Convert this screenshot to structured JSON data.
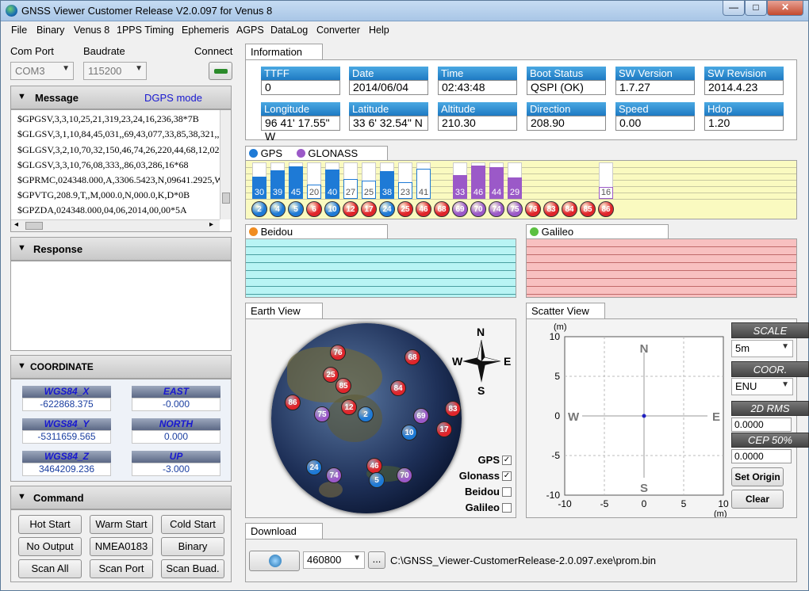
{
  "window": {
    "title": "GNSS Viewer Customer Release V2.0.097 for Venus 8",
    "buttons": {
      "minimize": "—",
      "maximize": "□",
      "close": "✕"
    }
  },
  "menu": [
    "File",
    "Binary",
    "Venus 8",
    "1PPS Timing",
    "Ephemeris",
    "AGPS",
    "DataLog",
    "Converter",
    "Help"
  ],
  "connection": {
    "com_port_label": "Com Port",
    "com_port_value": "COM3",
    "baudrate_label": "Baudrate",
    "baudrate_value": "115200",
    "connect_label": "Connect"
  },
  "message": {
    "title": "Message",
    "mode": "DGPS mode",
    "lines": [
      "$GPGSV,3,3,10,25,21,319,23,24,16,236,38*7B",
      "$GLGSV,3,1,10,84,45,031,,69,43,077,33,85,38,321,,",
      "$GLGSV,3,2,10,70,32,150,46,74,26,220,44,68,12,020",
      "$GLGSV,3,3,10,76,08,333,,86,03,286,16*68",
      "$GPRMC,024348.000,A,3306.5423,N,09641.2925,W",
      "$GPVTG,208.9,T,,M,000.0,N,000.0,K,D*0B",
      "$GPZDA,024348.000,04,06,2014,00,00*5A"
    ]
  },
  "response": {
    "title": "Response"
  },
  "coordinate": {
    "title": "COORDINATE",
    "items": [
      {
        "label": "WGS84_X",
        "value": "-622868.375"
      },
      {
        "label": "EAST",
        "value": "-0.000"
      },
      {
        "label": "WGS84_Y",
        "value": "-5311659.565"
      },
      {
        "label": "NORTH",
        "value": "0.000"
      },
      {
        "label": "WGS84_Z",
        "value": "3464209.236"
      },
      {
        "label": "UP",
        "value": "-3.000"
      }
    ]
  },
  "command": {
    "title": "Command",
    "buttons": [
      "Hot Start",
      "Warm Start",
      "Cold Start",
      "No Output",
      "NMEA0183",
      "Binary",
      "Scan All",
      "Scan Port",
      "Scan Buad."
    ]
  },
  "information": {
    "tab": "Information",
    "fields": [
      {
        "label": "TTFF",
        "value": "0"
      },
      {
        "label": "Date",
        "value": "2014/06/04"
      },
      {
        "label": "Time",
        "value": "02:43:48"
      },
      {
        "label": "Boot Status",
        "value": "QSPI (OK)"
      },
      {
        "label": "SW Version",
        "value": "1.7.27"
      },
      {
        "label": "SW Revision",
        "value": "2014.4.23"
      },
      {
        "label": "Longitude",
        "value": "96 41' 17.55\" W"
      },
      {
        "label": "Latitude",
        "value": "33 6' 32.54\" N"
      },
      {
        "label": "Altitude",
        "value": "210.30"
      },
      {
        "label": "Direction",
        "value": "208.90"
      },
      {
        "label": "Speed",
        "value": "0.00"
      },
      {
        "label": "Hdop",
        "value": "1.20"
      }
    ]
  },
  "signal": {
    "gps_label": "GPS",
    "glonass_label": "GLONASS",
    "gps_color": "#1e7ad6",
    "glonass_color": "#9b59c8",
    "bars": [
      {
        "snr": "30",
        "prn": "2",
        "sys": "gps",
        "level": 0.6,
        "used": true
      },
      {
        "snr": "39",
        "prn": "4",
        "sys": "gps",
        "level": 0.78,
        "used": true
      },
      {
        "snr": "45",
        "prn": "5",
        "sys": "gps",
        "level": 0.9,
        "used": true
      },
      {
        "snr": "20",
        "prn": "6",
        "sys": "gps",
        "level": 0.4,
        "used": false
      },
      {
        "snr": "40",
        "prn": "10",
        "sys": "gps",
        "level": 0.8,
        "used": true
      },
      {
        "snr": "27",
        "prn": "12",
        "sys": "gps",
        "level": 0.54,
        "used": false
      },
      {
        "snr": "25",
        "prn": "17",
        "sys": "gps",
        "level": 0.5,
        "used": false
      },
      {
        "snr": "38",
        "prn": "24",
        "sys": "gps",
        "level": 0.76,
        "used": true
      },
      {
        "snr": "23",
        "prn": "25",
        "sys": "gps",
        "level": 0.46,
        "used": false
      },
      {
        "snr": "41",
        "prn": "46",
        "sys": "gps",
        "level": 0.82,
        "used": false
      },
      {
        "snr": "",
        "prn": "68",
        "sys": "gps",
        "level": 0,
        "used": false
      },
      {
        "snr": "33",
        "prn": "69",
        "sys": "glo",
        "level": 0.66,
        "used": true
      },
      {
        "snr": "46",
        "prn": "70",
        "sys": "glo",
        "level": 0.92,
        "used": true
      },
      {
        "snr": "44",
        "prn": "74",
        "sys": "glo",
        "level": 0.88,
        "used": true
      },
      {
        "snr": "29",
        "prn": "75",
        "sys": "glo",
        "level": 0.58,
        "used": true
      },
      {
        "snr": "",
        "prn": "76",
        "sys": "glo",
        "level": 0,
        "used": false
      },
      {
        "snr": "",
        "prn": "83",
        "sys": "glo",
        "level": 0,
        "used": false
      },
      {
        "snr": "",
        "prn": "84",
        "sys": "glo",
        "level": 0,
        "used": false
      },
      {
        "snr": "",
        "prn": "85",
        "sys": "glo",
        "level": 0,
        "used": false
      },
      {
        "snr": "16",
        "prn": "86",
        "sys": "glo",
        "level": 0.32,
        "used": false
      }
    ]
  },
  "beidou": {
    "label": "Beidou",
    "color": "#f08c20"
  },
  "galileo": {
    "label": "Galileo",
    "color": "#5cc040"
  },
  "earth_view": {
    "tab": "Earth View",
    "compass": {
      "n": "N",
      "s": "S",
      "e": "E",
      "w": "W"
    },
    "sats": [
      {
        "prn": "76",
        "sys": "glo",
        "used": false
      },
      {
        "prn": "68",
        "sys": "gps",
        "used": false
      },
      {
        "prn": "25",
        "sys": "gps",
        "used": false
      },
      {
        "prn": "85",
        "sys": "glo",
        "used": false
      },
      {
        "prn": "84",
        "sys": "glo",
        "used": false
      },
      {
        "prn": "86",
        "sys": "glo",
        "used": false
      },
      {
        "prn": "12",
        "sys": "gps",
        "used": false
      },
      {
        "prn": "75",
        "sys": "glo",
        "used": true
      },
      {
        "prn": "2",
        "sys": "gps",
        "used": true
      },
      {
        "prn": "83",
        "sys": "glo",
        "used": false
      },
      {
        "prn": "69",
        "sys": "glo",
        "used": true
      },
      {
        "prn": "10",
        "sys": "gps",
        "used": true
      },
      {
        "prn": "17",
        "sys": "gps",
        "used": false
      },
      {
        "prn": "24",
        "sys": "gps",
        "used": true
      },
      {
        "prn": "74",
        "sys": "glo",
        "used": true
      },
      {
        "prn": "46",
        "sys": "gps",
        "used": false
      },
      {
        "prn": "5",
        "sys": "gps",
        "used": true
      },
      {
        "prn": "70",
        "sys": "glo",
        "used": true
      }
    ],
    "filters": [
      {
        "label": "GPS",
        "checked": true
      },
      {
        "label": "Glonass",
        "checked": true
      },
      {
        "label": "Beidou",
        "checked": false
      },
      {
        "label": "Galileo",
        "checked": false
      }
    ]
  },
  "scatter_view": {
    "tab": "Scatter View",
    "unit_top": "(m)",
    "unit_bottom": "(m)",
    "y_ticks": [
      "10",
      "5",
      "0",
      "-5",
      "-10"
    ],
    "x_ticks": [
      "-10",
      "-5",
      "0",
      "5",
      "10"
    ],
    "n": "N",
    "s": "S",
    "e": "E",
    "w": "W",
    "point": {
      "x": 0,
      "y": 0
    },
    "scale_label": "SCALE",
    "scale_value": "5m",
    "coor_label": "COOR.",
    "coor_value": "ENU",
    "rms_label": "2D RMS",
    "rms_value": "0.0000",
    "cep_label": "CEP 50%",
    "cep_value": "0.0000",
    "set_origin": "Set Origin",
    "clear": "Clear"
  },
  "download": {
    "tab": "Download",
    "baud": "460800",
    "browse": "...",
    "path": "C:\\GNSS_Viewer-CustomerRelease-2.0.097.exe\\prom.bin"
  }
}
